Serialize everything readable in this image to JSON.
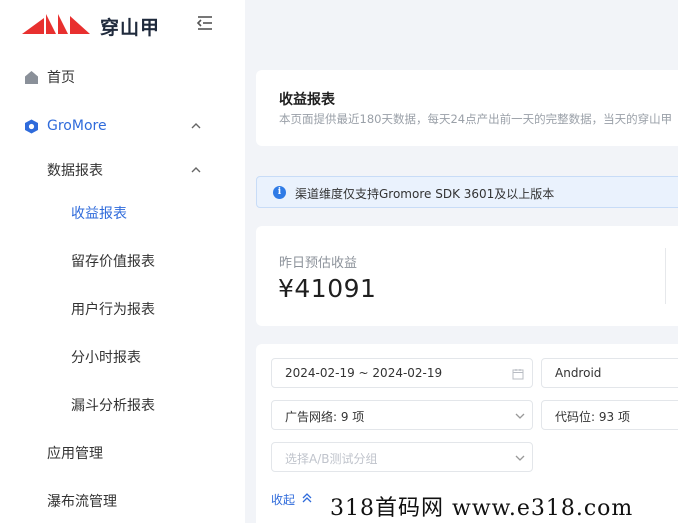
{
  "brand": {
    "name": "穿山甲"
  },
  "sidebar": {
    "items": [
      {
        "label": "首页",
        "icon": "home-icon"
      },
      {
        "label": "GroMore",
        "icon": "gromore-icon",
        "expanded": true
      },
      {
        "label": "数据报表",
        "expanded": true
      },
      {
        "label": "收益报表",
        "active": true
      },
      {
        "label": "留存价值报表"
      },
      {
        "label": "用户行为报表"
      },
      {
        "label": "分小时报表"
      },
      {
        "label": "漏斗分析报表"
      },
      {
        "label": "应用管理"
      },
      {
        "label": "瀑布流管理"
      }
    ]
  },
  "header": {
    "title": "收益报表",
    "description": "本页面提供最近180天数据，每天24点产出前一天的完整数据，当天的穿山甲"
  },
  "notice": {
    "text": "渠道维度仅支持Gromore SDK 3601及以上版本"
  },
  "stats": {
    "label": "昨日预估收益",
    "value": "¥41091"
  },
  "filters": {
    "date_range": "2024-02-19 ~ 2024-02-19",
    "platform": "Android",
    "ad_network": "广告网络: 9 项",
    "ad_slot": "代码位: 93 项",
    "ab_test_placeholder": "选择A/B测试分组",
    "collapse_label": "收起"
  },
  "watermark": {
    "text": "318首码网 www.e318.com"
  },
  "colors": {
    "accent": "#2f6bdb",
    "brand_red": "#e8302f",
    "notice_bg": "#eaf2fd"
  }
}
